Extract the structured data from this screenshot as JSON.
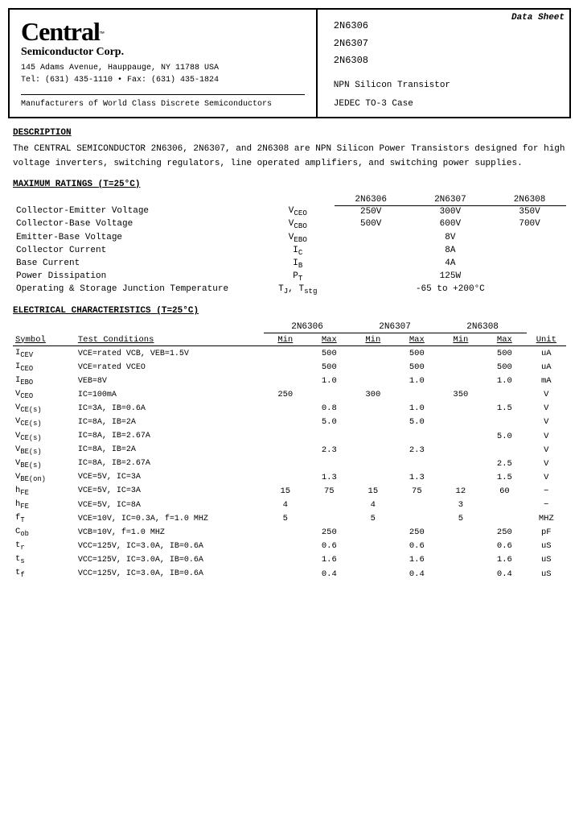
{
  "header": {
    "data_sheet_label": "Data Sheet",
    "company_name": "Central",
    "company_tm": "™",
    "company_sub": "Semiconductor Corp.",
    "company_addr1": "145 Adams Avenue, Hauppauge, NY  11788  USA",
    "company_addr2": "Tel: (631) 435-1110  •  Fax: (631) 435-1824",
    "company_mfr": "Manufacturers of World Class Discrete Semiconductors",
    "part_numbers": [
      "2N6306",
      "2N6307",
      "2N6308"
    ],
    "part_desc": "NPN Silicon Transistor",
    "part_case": "JEDEC TO-3 Case"
  },
  "description": {
    "title": "DESCRIPTION",
    "text": "The CENTRAL SEMICONDUCTOR 2N6306, 2N6307, and 2N6308 are NPN Silicon Power Transistors designed for high voltage inverters, switching regulators, line operated amplifiers, and switching power supplies."
  },
  "max_ratings": {
    "title": "MAXIMUM RATINGS",
    "condition": "(T=25°C)",
    "col_headers": [
      "2N6306",
      "2N6307",
      "2N6308"
    ],
    "rows": [
      {
        "param": "Collector-Emitter Voltage",
        "symbol": "VCEO",
        "n6306": "250V",
        "n6307": "300V",
        "n6308": "350V"
      },
      {
        "param": "Collector-Base Voltage",
        "symbol": "VCBO",
        "n6306": "500V",
        "n6307": "600V",
        "n6308": "700V"
      },
      {
        "param": "Emitter-Base Voltage",
        "symbol": "VEBO",
        "n6306": "",
        "n6307": "8V",
        "n6308": ""
      },
      {
        "param": "Collector Current",
        "symbol": "IC",
        "n6306": "",
        "n6307": "8A",
        "n6308": ""
      },
      {
        "param": "Base Current",
        "symbol": "IB",
        "n6306": "",
        "n6307": "4A",
        "n6308": ""
      },
      {
        "param": "Power Dissipation",
        "symbol": "PT",
        "n6306": "",
        "n6307": "125W",
        "n6308": ""
      },
      {
        "param": "Operating & Storage Junction Temperature",
        "symbol": "TJ, Tstg",
        "n6306": "",
        "n6307": "-65 to +200°C",
        "n6308": ""
      }
    ]
  },
  "elec_char": {
    "title": "ELECTRICAL CHARACTERISTICS",
    "condition": "(T=25°C)",
    "col_headers": {
      "part1": "2N6306",
      "part2": "2N6307",
      "part3": "2N6308"
    },
    "table_headers": [
      "Symbol",
      "Test Conditions",
      "Min",
      "Max",
      "Min",
      "Max",
      "Min",
      "Max",
      "Unit"
    ],
    "rows": [
      {
        "symbol": "ICEV",
        "conditions": "VCE=rated VCB, VEB=1.5V",
        "min1": "",
        "max1": "500",
        "min2": "",
        "max2": "500",
        "min3": "",
        "max3": "500",
        "unit": "uA"
      },
      {
        "symbol": "ICEO",
        "conditions": "VCE=rated VCEO",
        "min1": "",
        "max1": "500",
        "min2": "",
        "max2": "500",
        "min3": "",
        "max3": "500",
        "unit": "uA"
      },
      {
        "symbol": "IEBO",
        "conditions": "VEB=8V",
        "min1": "",
        "max1": "1.0",
        "min2": "",
        "max2": "1.0",
        "min3": "",
        "max3": "1.0",
        "unit": "mA"
      },
      {
        "symbol": "VCEO",
        "conditions": "IC=100mA",
        "min1": "250",
        "max1": "",
        "min2": "300",
        "max2": "",
        "min3": "350",
        "max3": "",
        "unit": "V"
      },
      {
        "symbol": "VCE(s)",
        "conditions": "IC=3A, IB=0.6A",
        "min1": "",
        "max1": "0.8",
        "min2": "",
        "max2": "1.0",
        "min3": "",
        "max3": "1.5",
        "unit": "V"
      },
      {
        "symbol": "VCE(s)",
        "conditions": "IC=8A, IB=2A",
        "min1": "",
        "max1": "5.0",
        "min2": "",
        "max2": "5.0",
        "min3": "",
        "max3": "",
        "unit": "V"
      },
      {
        "symbol": "VCE(s)",
        "conditions": "IC=8A, IB=2.67A",
        "min1": "",
        "max1": "",
        "min2": "",
        "max2": "",
        "min3": "",
        "max3": "5.0",
        "unit": "V"
      },
      {
        "symbol": "VBE(s)",
        "conditions": "IC=8A, IB=2A",
        "min1": "",
        "max1": "2.3",
        "min2": "",
        "max2": "2.3",
        "min3": "",
        "max3": "",
        "unit": "V"
      },
      {
        "symbol": "VBE(s)",
        "conditions": "IC=8A, IB=2.67A",
        "min1": "",
        "max1": "",
        "min2": "",
        "max2": "",
        "min3": "",
        "max3": "2.5",
        "unit": "V"
      },
      {
        "symbol": "VBE(on)",
        "conditions": "VCE=5V, IC=3A",
        "min1": "",
        "max1": "1.3",
        "min2": "",
        "max2": "1.3",
        "min3": "",
        "max3": "1.5",
        "unit": "V"
      },
      {
        "symbol": "hFE",
        "conditions": "VCE=5V, IC=3A",
        "min1": "15",
        "max1": "75",
        "min2": "15",
        "max2": "75",
        "min3": "12",
        "max3": "60",
        "unit": "−"
      },
      {
        "symbol": "hFE",
        "conditions": "VCE=5V, IC=8A",
        "min1": "4",
        "max1": "",
        "min2": "4",
        "max2": "",
        "min3": "3",
        "max3": "",
        "unit": "−"
      },
      {
        "symbol": "fT",
        "conditions": "VCE=10V, IC=0.3A, f=1.0 MHZ",
        "min1": "5",
        "max1": "",
        "min2": "5",
        "max2": "",
        "min3": "5",
        "max3": "",
        "unit": "MHZ"
      },
      {
        "symbol": "Cob",
        "conditions": "VCB=10V, f=1.0 MHZ",
        "min1": "",
        "max1": "250",
        "min2": "",
        "max2": "250",
        "min3": "",
        "max3": "250",
        "unit": "pF"
      },
      {
        "symbol": "tr",
        "conditions": "VCC=125V, IC=3.0A, IB=0.6A",
        "min1": "",
        "max1": "0.6",
        "min2": "",
        "max2": "0.6",
        "min3": "",
        "max3": "0.6",
        "unit": "uS"
      },
      {
        "symbol": "ts",
        "conditions": "VCC=125V, IC=3.0A, IB=0.6A",
        "min1": "",
        "max1": "1.6",
        "min2": "",
        "max2": "1.6",
        "min3": "",
        "max3": "1.6",
        "unit": "uS"
      },
      {
        "symbol": "tf",
        "conditions": "VCC=125V, IC=3.0A, IB=0.6A",
        "min1": "",
        "max1": "0.4",
        "min2": "",
        "max2": "0.4",
        "min3": "",
        "max3": "0.4",
        "unit": "uS"
      }
    ]
  }
}
